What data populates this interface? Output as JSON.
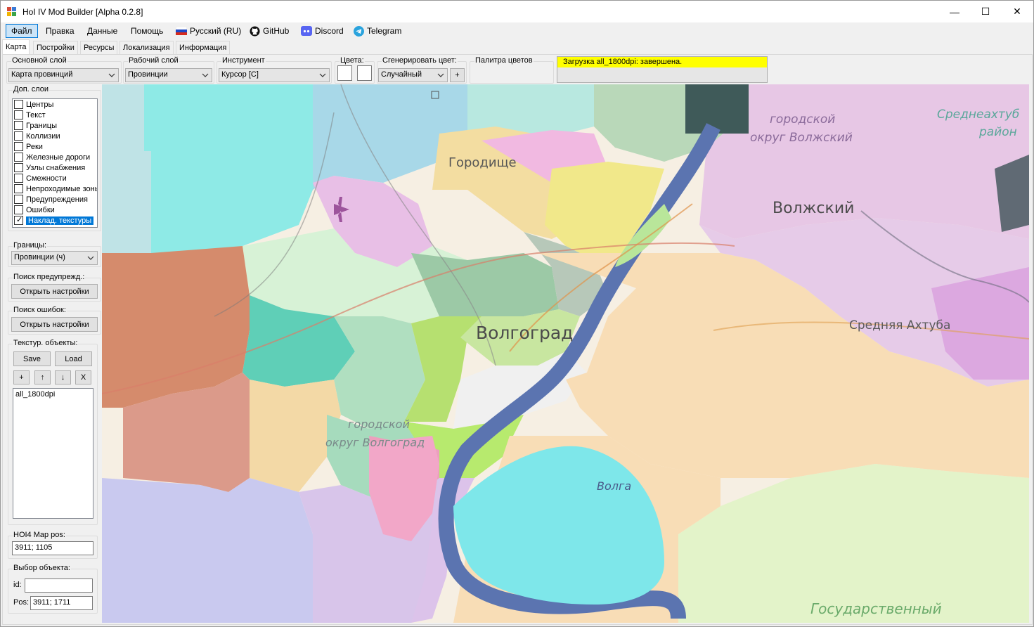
{
  "window": {
    "title": "HoI IV Mod Builder [Alpha 0.2.8]",
    "minimize_glyph": "—",
    "maximize_glyph": "☐",
    "close_glyph": "✕"
  },
  "menu": {
    "file": "Файл",
    "edit": "Правка",
    "data": "Данные",
    "help": "Помощь",
    "language": "Русский (RU)",
    "github": "GitHub",
    "discord": "Discord",
    "telegram": "Telegram"
  },
  "tabs": [
    "Карта",
    "Постройки",
    "Ресурсы",
    "Локализация",
    "Информация"
  ],
  "toolbar": {
    "main_layer_label": "Основной слой",
    "main_layer_value": "Карта провинций",
    "work_layer_label": "Рабочий слой",
    "work_layer_value": "Провинции",
    "tool_label": "Инструмент",
    "tool_value": "Курсор [C]",
    "colors_label": "Цвета:",
    "generate_color_label": "Сгенерировать цвет:",
    "generate_color_value": "Случайный",
    "add_color_button": "+",
    "palette_label": "Палитра цветов",
    "status_text": "Загрузка all_1800dpi: завершена."
  },
  "layers": {
    "label": "Доп. слои",
    "items": [
      {
        "label": "Центры",
        "checked": false
      },
      {
        "label": "Текст",
        "checked": false
      },
      {
        "label": "Границы",
        "checked": false
      },
      {
        "label": "Коллизии",
        "checked": false
      },
      {
        "label": "Реки",
        "checked": false
      },
      {
        "label": "Железные дороги",
        "checked": false
      },
      {
        "label": "Узлы снабжения",
        "checked": false
      },
      {
        "label": "Смежности",
        "checked": false
      },
      {
        "label": "Непроходимые зоны",
        "checked": false
      },
      {
        "label": "Предупреждения",
        "checked": false
      },
      {
        "label": "Ошибки",
        "checked": false
      },
      {
        "label": "Наклад. текстуры",
        "checked": true
      }
    ]
  },
  "borders": {
    "label": "Границы:",
    "value": "Провинции (ч)"
  },
  "warnings_search": {
    "label": "Поиск предупрежд.:",
    "button": "Открыть настройки"
  },
  "errors_search": {
    "label": "Поиск ошибок:",
    "button": "Открыть настройки"
  },
  "texture_objects": {
    "label": "Текстур. объекты:",
    "save": "Save",
    "load": "Load",
    "add": "+",
    "up": "↑",
    "down": "↓",
    "remove": "X",
    "items": [
      "all_1800dpi"
    ]
  },
  "map_pos": {
    "label": "HOI4 Map pos:",
    "value": "3911; 1105"
  },
  "object_select": {
    "label": "Выбор объекта:",
    "id_label": "id:",
    "id_value": "",
    "pos_label": "Pos:",
    "pos_value": "3911; 1711"
  },
  "map_labels": {
    "gorodishche": "Городище",
    "volgograd": "Волгоград",
    "volzhsky": "Волжский",
    "volzhsky_district_1": "городской",
    "volzhsky_district_2": "округ Волжский",
    "volgograd_district_1": "городской",
    "volgograd_district_2": "округ Волгоград",
    "srednyaya_akhtuba": "Средняя Ахтуба",
    "sredneakhtubinsky_1": "Среднеахтуб",
    "sredneakhtubinsky_2": "район",
    "volga": "Волга",
    "gosudarstvenny": "Государственный"
  },
  "colors": {
    "accent": "#0078d7",
    "status_yellow": "#ffff00",
    "river": "#5a6fa6"
  }
}
